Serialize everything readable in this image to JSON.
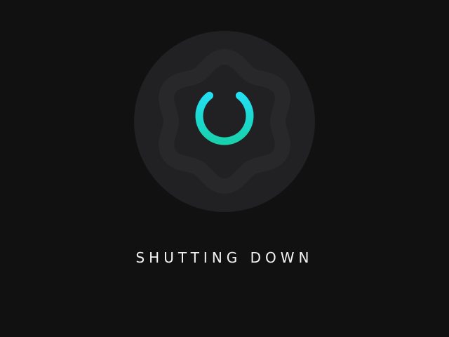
{
  "status": {
    "message": "SHUTTING DOWN"
  },
  "icon": {
    "name": "power-icon"
  },
  "colors": {
    "background": "#111112",
    "outer_circle": "#212124",
    "inner_wave": "#28282b",
    "accent_top": "#22dff2",
    "accent_bottom": "#18d2ad",
    "text": "#f2f2f2"
  }
}
